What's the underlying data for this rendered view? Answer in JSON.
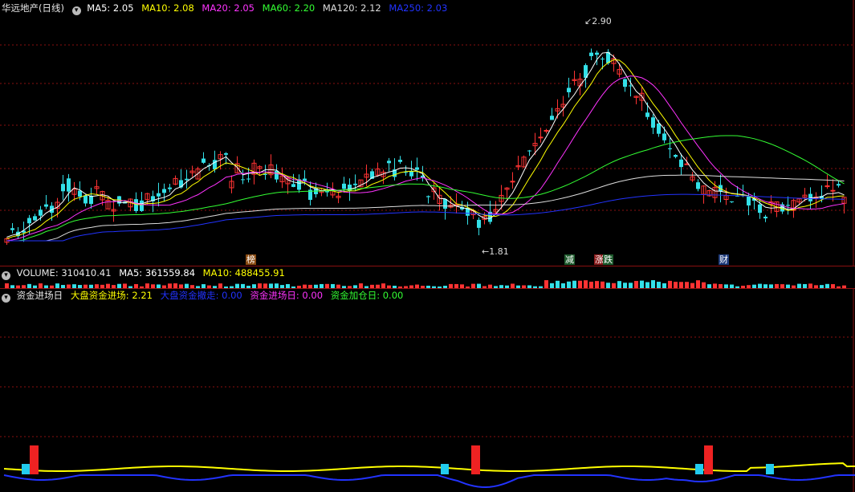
{
  "stock_legend": {
    "title": "华远地产(日线)",
    "items": [
      {
        "label": "MA5: 2.05",
        "color": "#ffffff"
      },
      {
        "label": "MA10: 2.08",
        "color": "#ffff00"
      },
      {
        "label": "MA20: 2.05",
        "color": "#ff33ff"
      },
      {
        "label": "MA60: 2.20",
        "color": "#33ff33"
      },
      {
        "label": "MA120: 2.12",
        "color": "#dddddd"
      },
      {
        "label": "MA250: 2.03",
        "color": "#2233ff"
      }
    ]
  },
  "price_notes": {
    "high": "2.90",
    "low": "1.81"
  },
  "event_tags": [
    {
      "text": "榜",
      "bg": "#8a4a10",
      "color": "#ffffff"
    },
    {
      "text": "减",
      "bg": "#1d5a2c",
      "color": "#ffffff"
    },
    {
      "text": "涨",
      "bg": "#8a1a1a",
      "color": "#ffffff"
    },
    {
      "text": "跌",
      "bg": "#1d5a2c",
      "color": "#ffffff"
    },
    {
      "text": "财",
      "bg": "#1d3a7a",
      "color": "#ffffff"
    }
  ],
  "volume_legend": {
    "title": "VOLUME: 310410.41",
    "items": [
      {
        "label": "MA5: 361559.84",
        "color": "#ffffff"
      },
      {
        "label": "MA10: 488455.91",
        "color": "#ffff00"
      }
    ]
  },
  "indicator_legend": {
    "title": "资金进场日",
    "items": [
      {
        "label": "大盘资金进场: 2.21",
        "color": "#ffff00"
      },
      {
        "label": "大盘资金撤走: 0.00",
        "color": "#2233ff"
      },
      {
        "label": "资金进场日: 0.00",
        "color": "#ff33ff"
      },
      {
        "label": "资金加仓日: 0.00",
        "color": "#33ff33"
      }
    ]
  },
  "colors": {
    "up": "#ff3333",
    "down": "#33e0e8",
    "border": "#8a1010"
  }
}
